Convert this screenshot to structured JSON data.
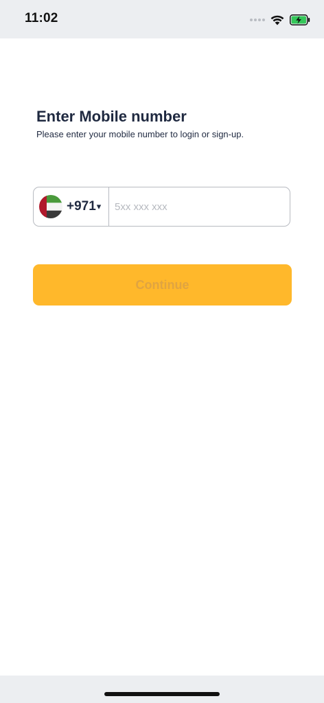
{
  "status_bar": {
    "time": "11:02",
    "icons": [
      "signal-dots-icon",
      "wifi-icon",
      "battery-charging-icon"
    ],
    "battery_color": "#34c759"
  },
  "login": {
    "title": "Enter Mobile number",
    "subtitle": "Please enter your mobile number to login or sign-up.",
    "country": {
      "flag": "uae-flag-icon",
      "dial_code": "+971",
      "caret": "▾"
    },
    "phone_input": {
      "value": "",
      "placeholder": "5xx xxx xxx"
    },
    "continue_label": "Continue"
  },
  "colors": {
    "accent": "#ffb82b",
    "text": "#1f2940",
    "button_text_disabled": "#e0a441",
    "border": "#b7bac0"
  }
}
